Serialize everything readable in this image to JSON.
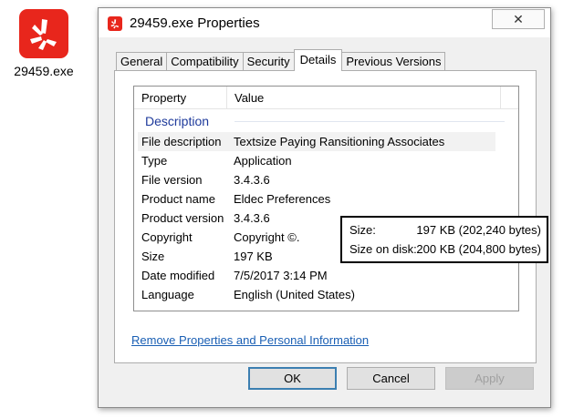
{
  "desktop": {
    "icon_label": "29459.exe",
    "icon": "yelp-burst-icon"
  },
  "window": {
    "title": "29459.exe Properties",
    "close_glyph": "✕"
  },
  "tabs": [
    {
      "label": "General"
    },
    {
      "label": "Compatibility"
    },
    {
      "label": "Security"
    },
    {
      "label": "Details",
      "active": true
    },
    {
      "label": "Previous Versions"
    }
  ],
  "details": {
    "col_property": "Property",
    "col_value": "Value",
    "group": "Description",
    "rows": [
      {
        "property": "File description",
        "value": "Textsize Paying Ransitioning Associates"
      },
      {
        "property": "Type",
        "value": "Application"
      },
      {
        "property": "File version",
        "value": "3.4.3.6"
      },
      {
        "property": "Product name",
        "value": "Eldec Preferences"
      },
      {
        "property": "Product version",
        "value": "3.4.3.6"
      },
      {
        "property": "Copyright",
        "value": "Copyright ©."
      },
      {
        "property": "Size",
        "value": "197 KB"
      },
      {
        "property": "Date modified",
        "value": "7/5/2017 3:14 PM"
      },
      {
        "property": "Language",
        "value": "English (United States)"
      }
    ]
  },
  "tooltip": {
    "size_label": "Size:",
    "size_value": "197 KB (202,240 bytes)",
    "disk_label": "Size on disk:",
    "disk_value": "200 KB (204,800 bytes)"
  },
  "link": "Remove Properties and Personal Information",
  "buttons": {
    "ok": "OK",
    "cancel": "Cancel",
    "apply": "Apply"
  },
  "colors": {
    "brand": "#e8261c",
    "link": "#1a5fb4",
    "group_header": "#1e3a9b"
  }
}
